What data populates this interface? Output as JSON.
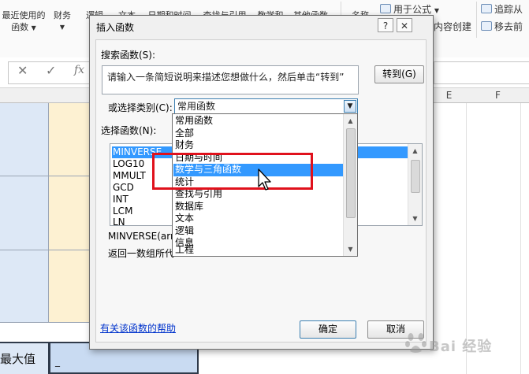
{
  "ribbon": {
    "recent_functions_line1": "最近使用的",
    "recent_functions_line2": "函数",
    "finance": "财务",
    "logic": "逻辑",
    "text": "文本",
    "datetime": "日期和时间",
    "lookup": "查找与引用",
    "math": "数学和",
    "other": "其他函数",
    "name": "名称",
    "use_in_formula": "用于公式",
    "create_from_selection": "内容创建",
    "trace_precedents": "追踪从",
    "remove_arrows": "移去前"
  },
  "formula_bar": {
    "cancel_icon": "✕",
    "enter_icon": "✓",
    "fx_label": "fx"
  },
  "grid": {
    "columns": [
      {
        "label": "E"
      },
      {
        "label": "F"
      }
    ],
    "max_label": "最大值",
    "selected_value": "_"
  },
  "dialog": {
    "title": "插入函数",
    "help_btn": "?",
    "close_btn": "✕",
    "search_label": "搜索函数(S):",
    "search_text": "请输入一条简短说明来描述您想做什么，然后单击“转到”",
    "go_button": "转到(G)",
    "category_label": "或选择类别(C):",
    "category_value": "常用函数",
    "select_function_label": "选择函数(N):",
    "functions": [
      "MINVERSE",
      "LOG10",
      "MMULT",
      "GCD",
      "INT",
      "LCM",
      "LN"
    ],
    "selected_function": "MINVERSE",
    "syntax": "MINVERSE(arr",
    "description": "返回一数组所代",
    "help_link": "有关该函数的帮助",
    "ok_button": "确定",
    "cancel_button": "取消"
  },
  "dropdown": {
    "items": [
      "常用函数",
      "全部",
      "财务",
      "日期与时间",
      "数学与三角函数",
      "统计",
      "查找与引用",
      "数据库",
      "文本",
      "逻辑",
      "信息",
      "工程"
    ],
    "highlighted_index": 4
  },
  "watermark": {
    "text": "Bai 经验"
  },
  "colors": {
    "highlight_blue": "#3399ff",
    "annotation_red": "#e0111c",
    "cell_blue": "#dde8f6",
    "cell_cream": "#fdf1d2"
  }
}
